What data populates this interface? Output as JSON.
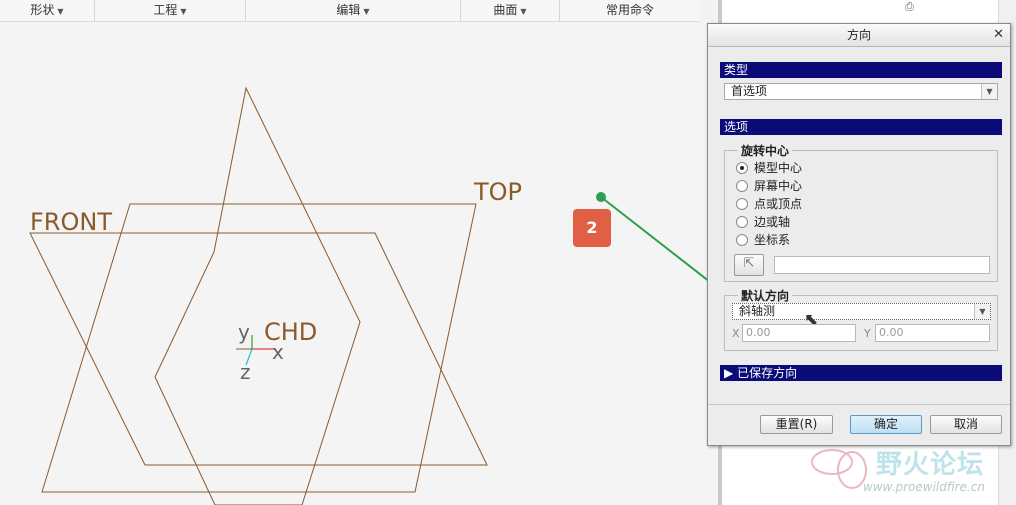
{
  "ribbon": {
    "groups": [
      {
        "label": "形状"
      },
      {
        "label": "工程"
      },
      {
        "label": "编辑"
      },
      {
        "label": "曲面"
      },
      {
        "label": "常用命令"
      }
    ]
  },
  "canvas": {
    "datum_labels": {
      "front": "FRONT",
      "top": "TOP",
      "csys": "CHD"
    },
    "axis_labels": {
      "y": "y",
      "x": "x",
      "z": "z"
    },
    "colors": {
      "datum": "#8a5a2b",
      "label": "#8a5a2b",
      "axis_x": "#d44",
      "axis_y": "#2a2",
      "axis_z": "#2bd"
    }
  },
  "callout": {
    "number": "2",
    "color": "#e05f45",
    "line_color": "#2e9e4f"
  },
  "dialog": {
    "title": "方向",
    "close_icon": "close-icon",
    "type_section": {
      "label": "类型",
      "selected": "首选项"
    },
    "options_section": {
      "label": "选项",
      "rotation_center": {
        "label": "旋转中心",
        "options": [
          {
            "label": "模型中心",
            "selected": true
          },
          {
            "label": "屏幕中心",
            "selected": false
          },
          {
            "label": "点或顶点",
            "selected": false
          },
          {
            "label": "边或轴",
            "selected": false
          },
          {
            "label": "坐标系",
            "selected": false
          }
        ]
      },
      "default_orientation": {
        "label": "默认方向",
        "selected": "斜轴测",
        "x_label": "X",
        "x_value": "0.00",
        "y_label": "Y",
        "y_value": "0.00"
      }
    },
    "saved_section": {
      "label": "已保存方向"
    },
    "buttons": {
      "reset": "重置(R)",
      "ok": "确定",
      "cancel": "取消"
    }
  },
  "watermark": {
    "text": "野火论坛",
    "url": "www.proewildfire.cn"
  }
}
